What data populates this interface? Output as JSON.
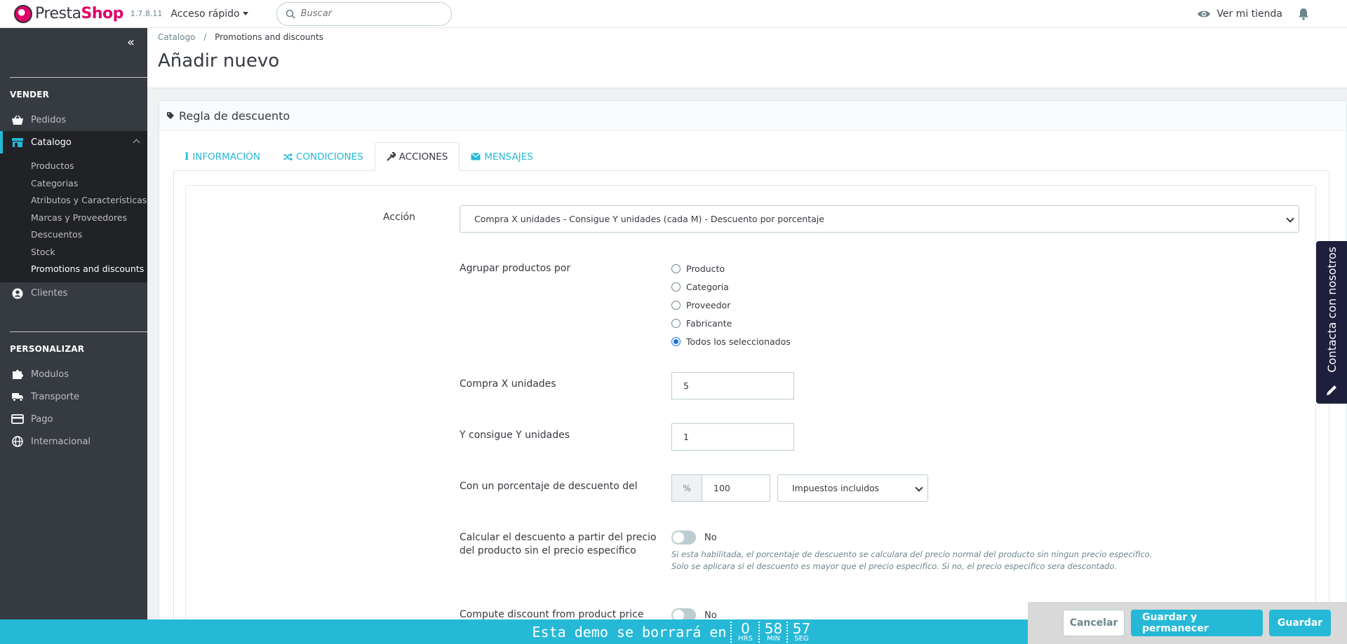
{
  "header": {
    "brand_prefix": "Presta",
    "brand_suffix": "Shop",
    "version": "1.7.8.11",
    "quick_access": "Acceso rápido",
    "search_placeholder": "Buscar",
    "view_store": "Ver mi tienda"
  },
  "sidebar": {
    "sections": [
      {
        "title": "VENDER"
      },
      {
        "title": "PERSONALIZAR"
      }
    ],
    "items": {
      "pedidos": "Pedidos",
      "catalogo": "Catalogo",
      "clientes": "Clientes",
      "modulos": "Modulos",
      "transporte": "Transporte",
      "pago": "Pago",
      "internacional": "Internacional"
    },
    "submenu": [
      "Productos",
      "Categorias",
      "Atributos y Características",
      "Marcas y Proveedores",
      "Descuentos",
      "Stock",
      "Promotions and discounts"
    ]
  },
  "breadcrumb": {
    "parent": "Catalogo",
    "separator": "/",
    "current": "Promotions and discounts"
  },
  "page_title": "Añadir nuevo",
  "panel": {
    "heading": "Regla de descuento",
    "tabs": [
      "INFORMACIÓN",
      "CONDICIONES",
      "ACCIONES",
      "MENSAJES"
    ],
    "active_tab": "ACCIONES"
  },
  "form": {
    "accion_label": "Acción",
    "accion_value": "Compra X unidades - Consigue Y unidades (cada M) - Descuento por porcentaje",
    "agrupar_label": "Agrupar productos por",
    "agrupar_options": [
      "Producto",
      "Categoria",
      "Proveedor",
      "Fabricante",
      "Todos los seleccionados"
    ],
    "agrupar_selected": "Todos los seleccionados",
    "compra_label": "Compra X unidades",
    "compra_value": "5",
    "consigue_label": "Y consigue Y unidades",
    "consigue_value": "1",
    "porcentaje_label": "Con un porcentaje de descuento del",
    "porcentaje_addon": "%",
    "porcentaje_value": "100",
    "impuestos_value": "Impuestos incluidos",
    "calcular_label_1": "Calcular el descuento a partir del precio",
    "calcular_label_2": "del producto sin el precio especifico",
    "calcular_value": "No",
    "calcular_help_1": "Si esta habilitada, el porcentaje de descuento se calculara del precio normal del producto sin ningun precio especifico.",
    "calcular_help_2": "Solo se aplicara si el descuento es mayor que el precio especifico. Si no, el precio especifico sera descontado.",
    "compute_label": "Compute discount from product price",
    "compute_value": "No"
  },
  "contact": "Contacta con nosotros",
  "demo_bar": {
    "message": "Esta demo se borrará en",
    "hours": "0",
    "hours_unit": "HRS",
    "minutes": "58",
    "minutes_unit": "MIN",
    "seconds": "57",
    "seconds_unit": "SEG"
  },
  "actions": {
    "cancel": "Cancelar",
    "save_stay": "Guardar y permanecer",
    "save": "Guardar"
  },
  "colors": {
    "accent": "#25b9d7",
    "brand": "#df0067",
    "sidebar": "#363a41"
  }
}
